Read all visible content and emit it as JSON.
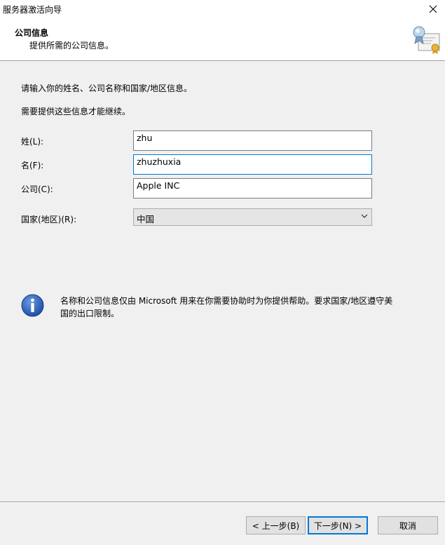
{
  "window": {
    "title": "服务器激活向导"
  },
  "header": {
    "title": "公司信息",
    "subtitle": "提供所需的公司信息。"
  },
  "body": {
    "intro_line1": "请输入你的姓名、公司名称和国家/地区信息。",
    "intro_line2": "需要提供这些信息才能继续。"
  },
  "form": {
    "last_name": {
      "label": "姓(L):",
      "value": "zhu"
    },
    "first_name": {
      "label": "名(F):",
      "value": "zhuzhuxia"
    },
    "company": {
      "label": "公司(C):",
      "value": "Apple INC"
    },
    "country": {
      "label": "国家(地区)(R):",
      "selected": "中国"
    }
  },
  "info": {
    "text": "名称和公司信息仅由 Microsoft 用来在你需要协助时为你提供帮助。要求国家/地区遵守美国的出口限制。"
  },
  "buttons": {
    "back": "< 上一步(B)",
    "next": "下一步(N) >",
    "cancel": "取消"
  },
  "icons": {
    "close": "close-icon",
    "certificate": "certificate-icon",
    "info": "info-icon",
    "dropdown": "chevron-down-icon"
  },
  "colors": {
    "accent": "#0078d7",
    "info_blue": "#1f4fa8"
  }
}
